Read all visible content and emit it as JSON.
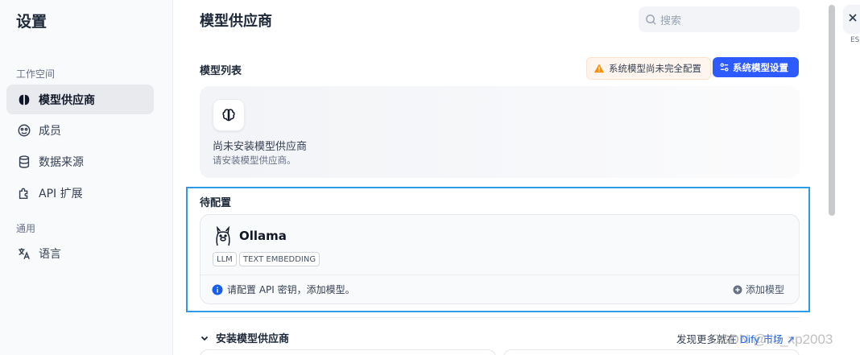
{
  "sidebar": {
    "title": "设置",
    "group_workspace": "工作空间",
    "group_general": "通用",
    "items": [
      {
        "label": "模型供应商",
        "icon": "brain-icon",
        "active": true
      },
      {
        "label": "成员",
        "icon": "members-icon",
        "active": false
      },
      {
        "label": "数据来源",
        "icon": "database-icon",
        "active": false
      },
      {
        "label": "API 扩展",
        "icon": "puzzle-icon",
        "active": false
      },
      {
        "label": "语言",
        "icon": "translate-icon",
        "active": false
      }
    ]
  },
  "header": {
    "title": "模型供应商",
    "search_placeholder": "搜索"
  },
  "model_list": {
    "label": "模型列表",
    "warning": "系统模型尚未完全配置",
    "system_settings_button": "系统模型设置",
    "empty_title": "尚未安装模型供应商",
    "empty_desc": "请安装模型供应商。"
  },
  "pending": {
    "label": "待配置",
    "provider": {
      "name": "Ollama",
      "tags": [
        "LLM",
        "TEXT EMBEDDING"
      ],
      "info": "请配置 API 密钥，添加模型。",
      "add_model": "添加模型"
    }
  },
  "install": {
    "label": "安装模型供应商",
    "discover_prefix": "发现更多就在",
    "discover_link": "Dify 市场"
  },
  "close": {
    "esc_label": "ESC"
  },
  "watermark": "CSDN @liu_xp2003",
  "colors": {
    "accent": "#2e5bff",
    "highlight_frame": "#2d9be6",
    "warning": "#f79009",
    "info": "#155eef"
  }
}
